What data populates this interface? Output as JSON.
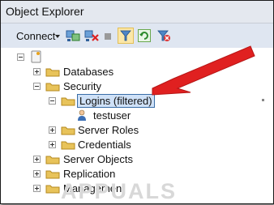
{
  "window": {
    "title": "Object Explorer"
  },
  "toolbar": {
    "connect_label": "Connect",
    "buttons": [
      "connect-server-icon",
      "disconnect-icon",
      "stop-icon",
      "filter-icon",
      "refresh-icon",
      "clear-filter-icon"
    ]
  },
  "tree": {
    "server_label": "",
    "items": [
      {
        "label": "Databases",
        "expanded": false
      },
      {
        "label": "Security",
        "expanded": true
      },
      {
        "label": "Logins (filtered)",
        "expanded": true,
        "selected": true
      },
      {
        "label": "testuser"
      },
      {
        "label": "Server Roles",
        "expanded": false
      },
      {
        "label": "Credentials",
        "expanded": false
      },
      {
        "label": "Server Objects",
        "expanded": false
      },
      {
        "label": "Replication",
        "expanded": false
      },
      {
        "label": "Management",
        "expanded": false
      }
    ]
  },
  "watermark": {
    "text": "APPUALS"
  },
  "colors": {
    "arrow": "#e02020",
    "toolbar": "#dfe6f1",
    "selection": "#cfe1f7",
    "folder": "#e8c35a"
  }
}
